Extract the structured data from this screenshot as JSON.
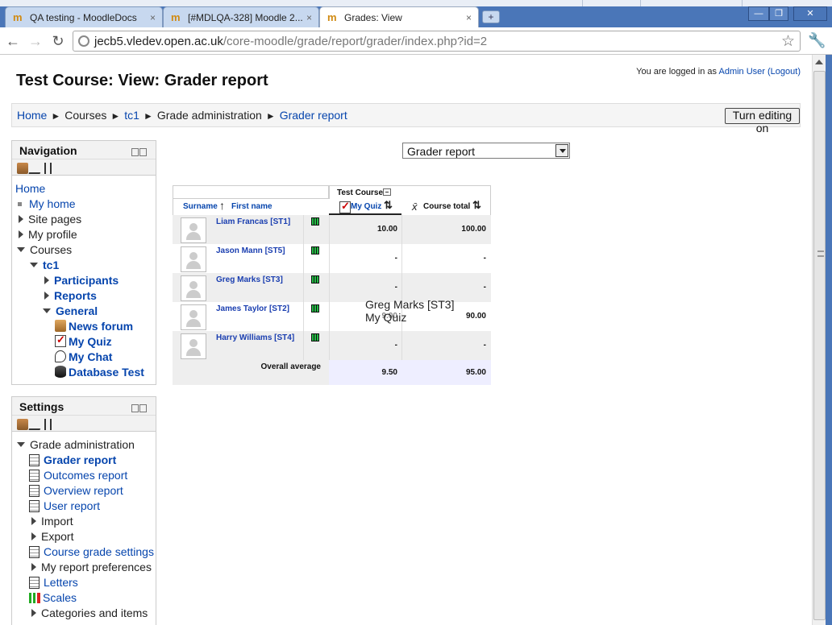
{
  "browser": {
    "tabs": [
      {
        "title": "QA testing - MoodleDocs",
        "close": "×"
      },
      {
        "title": "[#MDLQA-328] Moodle 2...",
        "close": "×"
      },
      {
        "title": "Grades: View",
        "close": "×"
      }
    ],
    "new_tab": "+",
    "url_host": "jecb5.vledev.open.ac.uk",
    "url_path": "/core-moodle/grade/report/grader/index.php?id=2",
    "window": {
      "minimize": "—",
      "maximize": "❐",
      "close": "✕"
    }
  },
  "page": {
    "login_prefix": "You are logged in as ",
    "login_user": "Admin User",
    "logout": "(Logout)",
    "title": "Test Course: View: Grader report",
    "turn_editing": "Turn editing on",
    "report_select": "Grader report"
  },
  "breadcrumb": {
    "items": [
      "Home",
      "Courses",
      "tc1",
      "Grade administration",
      "Grader report"
    ],
    "sep": "►"
  },
  "navigation": {
    "title": "Navigation",
    "home": "Home",
    "my_home": "My home",
    "site_pages": "Site pages",
    "my_profile": "My profile",
    "courses": "Courses",
    "tc1": "tc1",
    "participants": "Participants",
    "reports": "Reports",
    "general": "General",
    "news_forum": "News forum",
    "my_quiz": "My Quiz",
    "my_chat": "My Chat",
    "database_test": "Database Test"
  },
  "settings": {
    "title": "Settings",
    "grade_admin": "Grade administration",
    "grader_report": "Grader report",
    "outcomes_report": "Outcomes report",
    "overview_report": "Overview report",
    "user_report": "User report",
    "import": "Import",
    "export": "Export",
    "course_grade_settings": "Course grade settings",
    "my_report_preferences": "My report preferences",
    "letters": "Letters",
    "scales": "Scales",
    "categories_items": "Categories and items"
  },
  "grader": {
    "course_header": "Test Course",
    "surname": "Surname",
    "first_name": "First name",
    "arrow_up": "↑",
    "sort_icon": "⇅",
    "my_quiz": "My Quiz",
    "course_total": "Course total",
    "xbar": "x̄",
    "students": [
      {
        "name": "Liam Francas [ST1]",
        "quiz": "10.00",
        "total": "100.00"
      },
      {
        "name": "Jason Mann [ST5]",
        "quiz": "-",
        "total": "-"
      },
      {
        "name": "Greg Marks [ST3]",
        "quiz": "-",
        "total": "-"
      },
      {
        "name": "James Taylor [ST2]",
        "quiz": "9.00",
        "total": "90.00"
      },
      {
        "name": "Harry Williams [ST4]",
        "quiz": "-",
        "total": "-"
      }
    ],
    "overall_average": "Overall average",
    "avg_quiz": "9.50",
    "avg_total": "95.00",
    "tooltip_line1": "Greg Marks [ST3]",
    "tooltip_line2": "My Quiz"
  }
}
